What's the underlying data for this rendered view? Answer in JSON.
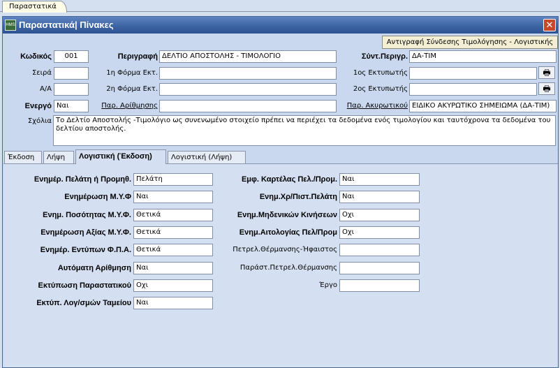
{
  "outer_tab": "Παραστατικά",
  "window": {
    "title": "Παραστατικά| Πίνακες",
    "icon_text": "HMS",
    "close_glyph": "✕"
  },
  "copy_button": "Αντιγραφή Σύνδεσης Τιμολόγησης - Λογιστικής",
  "header": {
    "code_label": "Κωδικός",
    "code_value": "001",
    "series_label": "Σειρά",
    "series_value": "",
    "aa_label": "Α/Α",
    "aa_value": "",
    "active_label": "Ενεργό",
    "active_value": "Ναι",
    "desc_label": "Περιγραφή",
    "desc_value": "ΔΕΛΤΙΟ ΑΠΟΣΤΟΛΗΣ - ΤΙΜΟΛΟΓΙΟ",
    "form1_label": "1η Φόρμα Εκτ.",
    "form1_value": "",
    "form2_label": "2η Φόρμα Εκτ.",
    "form2_value": "",
    "numbering_label": "Παρ. Αρίθμησης",
    "numbering_value": "",
    "short_desc_label": "Σύντ.Περιγρ.",
    "short_desc_value": "ΔΑ-ΤΙΜ",
    "printer1_label": "1ος Εκτυπωτής",
    "printer1_value": "",
    "printer2_label": "2ος Εκτυπωτής",
    "printer2_value": "",
    "cancel_label": "Παρ. Ακυρωτικού",
    "cancel_value": "ΕΙΔΙΚΟ ΑΚΥΡΩΤΙΚΟ ΣΗΜΕΙΩΜΑ (ΔΑ-ΤΙΜ)",
    "printer_glyph": "🖶"
  },
  "remarks": {
    "label": "Σχόλια",
    "value": "Το Δελτίο Αποστολής -Τιμολόγιο ως συνενωμένο στοιχείο πρέπει να περιέχει τα δεδομένα ενός τιμολογίου και ταυτόχρονα τα δεδομένα του δελτίου αποστολής."
  },
  "tabs": [
    "Έκδοση",
    "Λήψη",
    "Λογιστική (Έκδοση)",
    "Λογιστική (Λήψη)"
  ],
  "active_tab": 2,
  "left_fields": [
    {
      "label": "Ενημέρ. Πελάτη ή Προμηθ.",
      "value": "Πελάτη"
    },
    {
      "label": "Ενημέρωση Μ.Υ.Φ",
      "value": "Ναι"
    },
    {
      "label": "Ενημ. Ποσότητας Μ.Υ.Φ.",
      "value": "Θετικά"
    },
    {
      "label": "Ενημέρωση Αξίας Μ.Υ.Φ.",
      "value": "Θετικά"
    },
    {
      "label": "Ενημέρ. Εντύπων Φ.Π.Α.",
      "value": "Θετικά"
    },
    {
      "label": "Αυτόματη Αρίθμηση",
      "value": "Ναι"
    },
    {
      "label": "Εκτύπωση Παραστατικού",
      "value": "Οχι"
    },
    {
      "label": "Εκτύπ. Λογ/σμών Ταμείου",
      "value": "Ναι"
    }
  ],
  "right_fields": [
    {
      "label": "Εμφ. Καρτέλας Πελ./Προμ.",
      "value": "Ναι",
      "bold": true
    },
    {
      "label": "Ενημ.Χρ/Πιστ.Πελάτη",
      "value": "Ναι",
      "bold": true
    },
    {
      "label": "Ενημ.Μηδενικών Κινήσεων",
      "value": "Οχι",
      "bold": true
    },
    {
      "label": "Ενημ.Αιτολογίας Πελ/Προμ",
      "value": "Οχι",
      "bold": true
    },
    {
      "label": "Πετρελ.Θέρμανσης-Ήφαιστος",
      "value": "",
      "bold": false
    },
    {
      "label": "Παράστ.Πετρελ.Θέρμανσης",
      "value": "",
      "bold": false
    },
    {
      "label": "Έργο",
      "value": "",
      "bold": false
    }
  ]
}
